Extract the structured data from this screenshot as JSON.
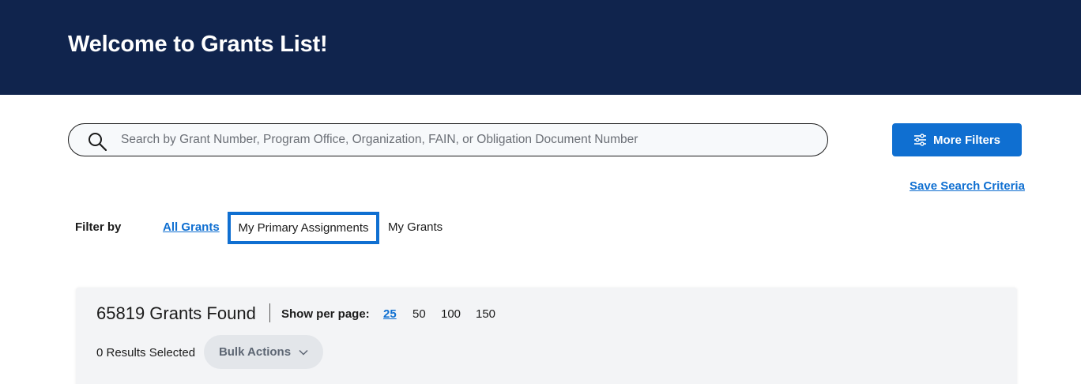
{
  "header": {
    "title": "Welcome to Grants List!"
  },
  "search": {
    "placeholder": "Search by Grant Number, Program Office, Organization, FAIN, or Obligation Document Number",
    "value": ""
  },
  "more_filters": {
    "label": "More Filters",
    "icon": "sliders-icon"
  },
  "save_search": {
    "label": "Save Search Criteria"
  },
  "filter": {
    "label": "Filter by",
    "options": [
      {
        "label": "All Grants",
        "state": "link"
      },
      {
        "label": "My Primary Assignments",
        "state": "focused"
      },
      {
        "label": "My Grants",
        "state": "plain"
      }
    ]
  },
  "results": {
    "found": "65819 Grants Found",
    "per_page_label": "Show per page:",
    "per_page_options": [
      "25",
      "50",
      "100",
      "150"
    ],
    "per_page_selected": "25",
    "selected": "0 Results Selected",
    "bulk_actions": "Bulk Actions"
  },
  "colors": {
    "header_bg": "#10244d",
    "primary": "#0f6fd1",
    "panel_bg": "#f3f4f6"
  }
}
